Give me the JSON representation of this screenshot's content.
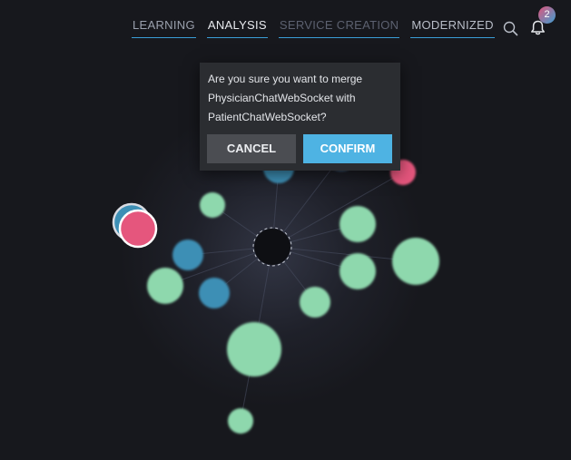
{
  "nav": {
    "tabs": [
      {
        "label": "LEARNING"
      },
      {
        "label": "ANALYSIS"
      },
      {
        "label": "SERVICE CREATION"
      },
      {
        "label": "MODERNIZED"
      }
    ],
    "search_icon": "search-icon",
    "bell_icon": "bell-icon",
    "notification_count": "2",
    "badge_color": "#e2557b"
  },
  "dialog": {
    "message": "Are you sure you want to merge PhysicianChatWebSocket with PatientChatWebSocket?",
    "cancel_label": "CANCEL",
    "confirm_label": "CONFIRM"
  },
  "colors": {
    "background": "#17181d",
    "node_green": "#8ed8ad",
    "node_blue": "#3d8fb5",
    "node_pink": "#e5567d",
    "confirm_button": "#4eb3e3",
    "tab_underline": "#3a9ed6"
  }
}
